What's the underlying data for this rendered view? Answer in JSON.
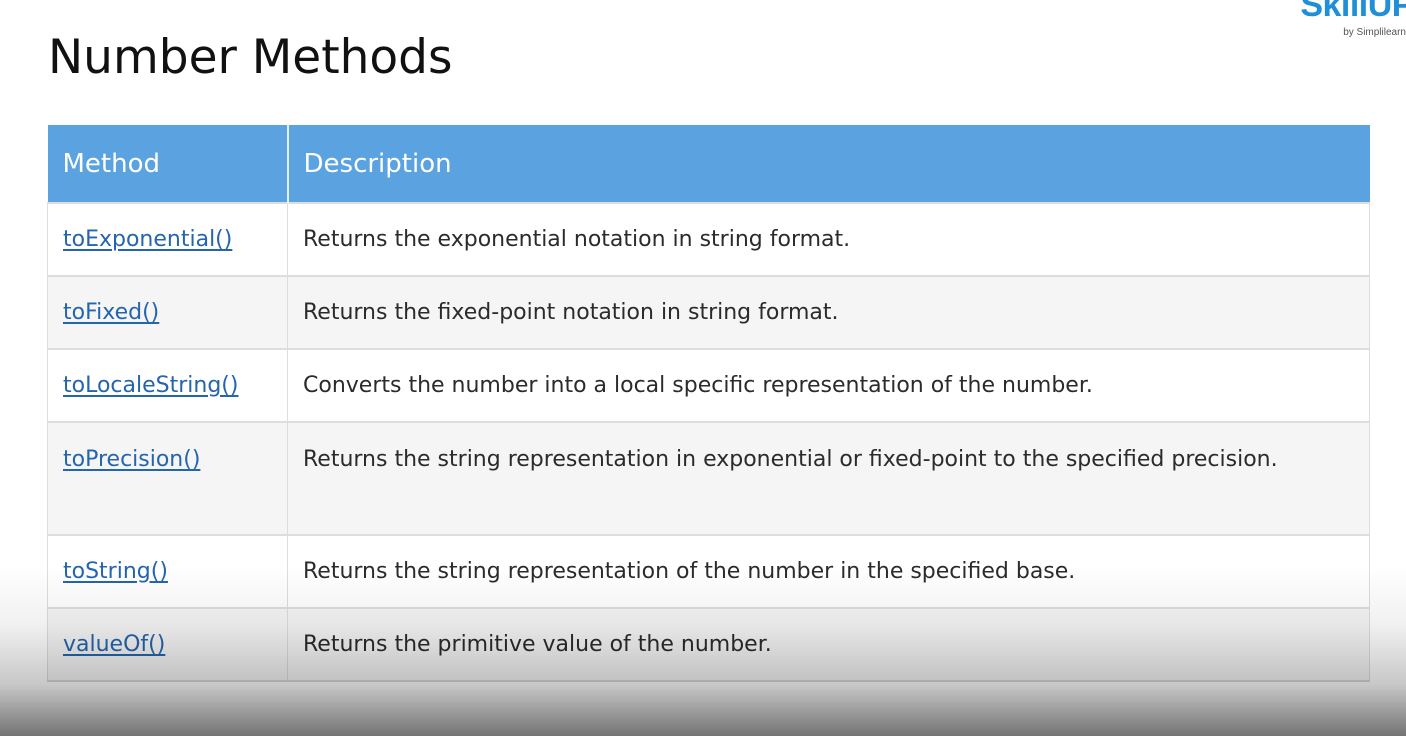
{
  "brand": {
    "logo_text": "SkillUP",
    "sub_text": "by Simplilearn",
    "color": "#1f8fd6"
  },
  "page": {
    "title": "Number Methods"
  },
  "table": {
    "header_color": "#5aa3e0",
    "link_color": "#2565ae",
    "columns": [
      "Method",
      "Description"
    ],
    "rows": [
      {
        "method": "toExponential()",
        "description": "Returns the exponential notation in string format."
      },
      {
        "method": "toFixed()",
        "description": "Returns the fixed-point notation in string format."
      },
      {
        "method": "toLocaleString()",
        "description": "Converts the number into a local specific representation of the number."
      },
      {
        "method": "toPrecision()",
        "description": "Returns the string representation in exponential or fixed-point to the specified precision."
      },
      {
        "method": "toString()",
        "description": "Returns the string representation of the number in the specified base."
      },
      {
        "method": "valueOf()",
        "description": "Returns the primitive value of the number."
      }
    ]
  }
}
